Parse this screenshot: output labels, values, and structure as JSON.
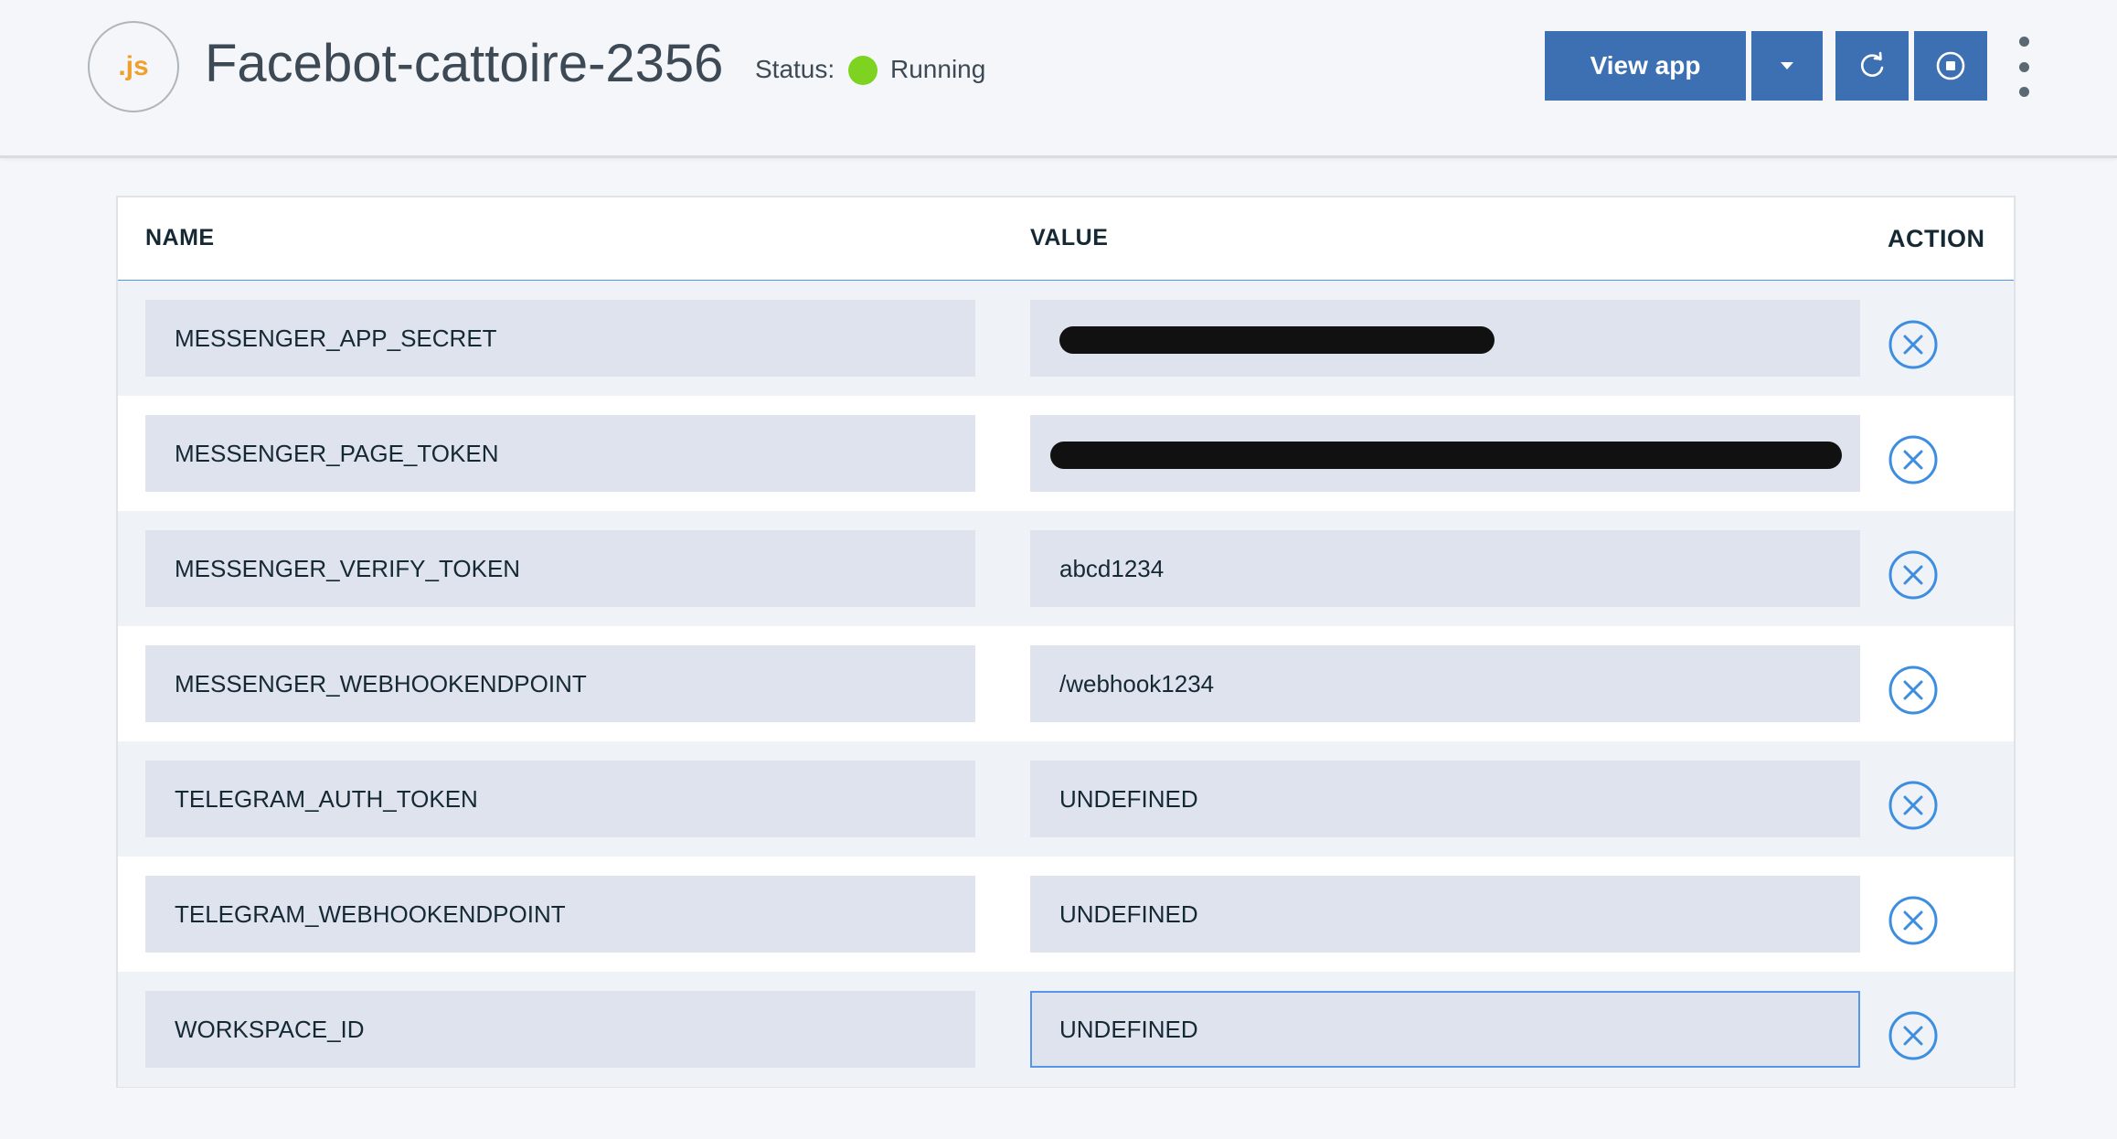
{
  "header": {
    "app_icon_label": ".js",
    "app_name": "Facebot-cattoire-2356",
    "status_label": "Status:",
    "status_value": "Running",
    "status_color": "#7ed321",
    "view_app_label": "View app",
    "accent_color": "#3d70b2",
    "icons": {
      "dropdown": "caret-down-icon",
      "restart": "restart-icon",
      "stop": "stop-icon",
      "more": "overflow-menu-icon"
    }
  },
  "table": {
    "columns": {
      "name": "NAME",
      "value": "VALUE",
      "action": "ACTION"
    },
    "rows": [
      {
        "name": "MESSENGER_APP_SECRET",
        "value": "",
        "redacted": true
      },
      {
        "name": "MESSENGER_PAGE_TOKEN",
        "value": "",
        "redacted": true
      },
      {
        "name": "MESSENGER_VERIFY_TOKEN",
        "value": "abcd1234",
        "redacted": false
      },
      {
        "name": "MESSENGER_WEBHOOKENDPOINT",
        "value": "/webhook1234",
        "redacted": false
      },
      {
        "name": "TELEGRAM_AUTH_TOKEN",
        "value": "UNDEFINED",
        "redacted": false
      },
      {
        "name": "TELEGRAM_WEBHOOKENDPOINT",
        "value": "UNDEFINED",
        "redacted": false
      },
      {
        "name": "WORKSPACE_ID",
        "value": "UNDEFINED",
        "redacted": false,
        "focused": true
      }
    ],
    "remove_icon": "close-circle-icon"
  }
}
